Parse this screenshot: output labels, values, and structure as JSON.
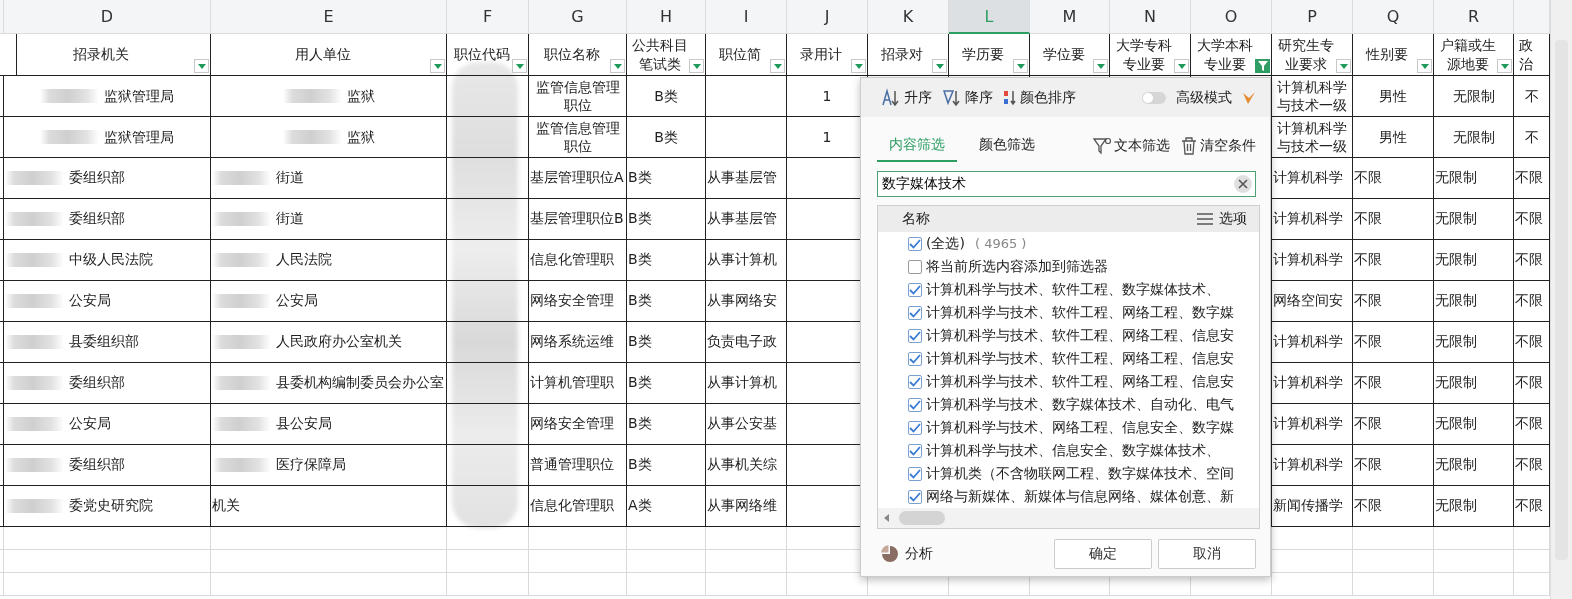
{
  "column_letters": [
    {
      "label": "D",
      "selected": false
    },
    {
      "label": "E",
      "selected": false
    },
    {
      "label": "F",
      "selected": false
    },
    {
      "label": "G",
      "selected": false
    },
    {
      "label": "H",
      "selected": false
    },
    {
      "label": "I",
      "selected": false
    },
    {
      "label": "J",
      "selected": false
    },
    {
      "label": "K",
      "selected": false
    },
    {
      "label": "L",
      "selected": true
    },
    {
      "label": "M",
      "selected": false
    },
    {
      "label": "N",
      "selected": false
    },
    {
      "label": "O",
      "selected": false
    },
    {
      "label": "P",
      "selected": false
    },
    {
      "label": "Q",
      "selected": false
    },
    {
      "label": "R",
      "selected": false
    }
  ],
  "header_row": [
    {
      "label": "招录机关",
      "kind": "filter",
      "filtered": false
    },
    {
      "label": "用人单位",
      "kind": "filter",
      "filtered": false
    },
    {
      "label": "职位代码",
      "kind": "filter",
      "filtered": false
    },
    {
      "label": "职位名称",
      "kind": "filter",
      "filtered": false
    },
    {
      "label": "公共科目笔试类",
      "kind": "filter",
      "filtered": false
    },
    {
      "label": "职位简",
      "kind": "filter",
      "filtered": false
    },
    {
      "label": "录用计",
      "kind": "filter",
      "filtered": false
    },
    {
      "label": "招录对",
      "kind": "filter",
      "filtered": false
    },
    {
      "label": "学历要",
      "kind": "filter",
      "filtered": false
    },
    {
      "label": "学位要",
      "kind": "filter",
      "filtered": false
    },
    {
      "label": "大学专科专业要",
      "kind": "filter",
      "filtered": false
    },
    {
      "label": "大学本科专业要",
      "kind": "filter",
      "filtered": true
    },
    {
      "label": "研究生专业要求",
      "kind": "filter",
      "filtered": false
    },
    {
      "label": "性别要",
      "kind": "filter",
      "filtered": false
    },
    {
      "label": "户籍或生源地要",
      "kind": "filter",
      "filtered": false
    },
    {
      "label": "政治",
      "kind": "plain"
    }
  ],
  "rows": [
    {
      "centered": true,
      "d_blurred": true,
      "e_blurred": true,
      "cells": {
        "D": "监狱管理局",
        "E": "监狱",
        "G": "监管信息管理职位",
        "H": "B类",
        "J": "1",
        "P": "计算机科学与技术一级",
        "Q": "男性",
        "R": "无限制",
        "S": "不"
      }
    },
    {
      "centered": true,
      "d_blurred": true,
      "e_blurred": true,
      "cells": {
        "D": "监狱管理局",
        "E": "监狱",
        "G": "监管信息管理职位",
        "H": "B类",
        "J": "1",
        "P": "计算机科学与技术一级",
        "Q": "男性",
        "R": "无限制",
        "S": "不"
      }
    },
    {
      "centered": false,
      "d_blurred": true,
      "e_blurred": true,
      "cells": {
        "D": "委组织部",
        "E": "街道",
        "G": "基层管理职位A",
        "H": "B类",
        "I": "从事基层管",
        "P": "计算机科学",
        "Q": "不限",
        "R": "无限制",
        "S": "不限"
      }
    },
    {
      "centered": false,
      "d_blurred": true,
      "e_blurred": true,
      "cells": {
        "D": "委组织部",
        "E": "街道",
        "G": "基层管理职位B",
        "H": "B类",
        "I": "从事基层管",
        "P": "计算机科学",
        "Q": "不限",
        "R": "无限制",
        "S": "不限"
      }
    },
    {
      "centered": false,
      "d_blurred": true,
      "e_blurred": true,
      "cells": {
        "D": "中级人民法院",
        "E": "人民法院",
        "G": "信息化管理职",
        "H": "B类",
        "I": "从事计算机",
        "P": "计算机科学",
        "Q": "不限",
        "R": "无限制",
        "S": "不限"
      }
    },
    {
      "centered": false,
      "d_blurred": true,
      "e_blurred": true,
      "cells": {
        "D": "公安局",
        "E": "公安局",
        "G": "网络安全管理",
        "H": "B类",
        "I": "从事网络安",
        "P": "网络空间安",
        "Q": "不限",
        "R": "无限制",
        "S": "不限"
      }
    },
    {
      "centered": false,
      "d_blurred": true,
      "e_blurred": true,
      "cells": {
        "D": "县委组织部",
        "E": "人民政府办公室机关",
        "G": "网络系统运维",
        "H": "B类",
        "I": "负责电子政",
        "P": "计算机科学",
        "Q": "不限",
        "R": "无限制",
        "S": "不限"
      }
    },
    {
      "centered": false,
      "d_blurred": true,
      "e_blurred": true,
      "cells": {
        "D": "委组织部",
        "E": "县委机构编制委员会办公室",
        "G": "计算机管理职",
        "H": "B类",
        "I": "从事计算机",
        "P": "计算机科学",
        "Q": "不限",
        "R": "无限制",
        "S": "不限"
      }
    },
    {
      "centered": false,
      "d_blurred": true,
      "e_blurred": true,
      "cells": {
        "D": "公安局",
        "E": "县公安局",
        "G": "网络安全管理",
        "H": "B类",
        "I": "从事公安基",
        "P": "计算机科学",
        "Q": "不限",
        "R": "无限制",
        "S": "不限"
      }
    },
    {
      "centered": false,
      "d_blurred": true,
      "e_blurred": true,
      "cells": {
        "D": "委组织部",
        "E": "医疗保障局",
        "G": "普通管理职位",
        "H": "B类",
        "I": "从事机关综",
        "P": "计算机科学",
        "Q": "不限",
        "R": "无限制",
        "S": "不限"
      }
    },
    {
      "centered": false,
      "d_blurred": true,
      "e_blurred": false,
      "cells": {
        "D": "委党史研究院",
        "E": "机关",
        "G": "信息化管理职",
        "H": "A类",
        "I": "从事网络维",
        "P": "新闻传播学",
        "Q": "不限",
        "R": "无限制",
        "S": "不限"
      }
    }
  ],
  "filter_popup": {
    "sort_buttons": [
      {
        "kind": "ascending",
        "label": "升序"
      },
      {
        "kind": "descending",
        "label": "降序"
      },
      {
        "kind": "color",
        "label": "颜色排序"
      }
    ],
    "advanced_mode": {
      "label": "高级模式",
      "on": false
    },
    "tabs": [
      {
        "label": "内容筛选",
        "selected": true
      },
      {
        "label": "颜色筛选",
        "selected": false
      }
    ],
    "actions": [
      {
        "kind": "text-filter",
        "label": "文本筛选"
      },
      {
        "kind": "clear",
        "label": "清空条件"
      }
    ],
    "search": {
      "value": "数字媒体技术"
    },
    "list_header": {
      "name": "名称",
      "options": "选项"
    },
    "items": [
      {
        "label": "(全选)",
        "count": "( 4965 )",
        "checked": true
      },
      {
        "label": "将当前所选内容添加到筛选器",
        "checked": false
      },
      {
        "label": "计算机科学与技术、软件工程、数字媒体技术、",
        "checked": true
      },
      {
        "label": "计算机科学与技术、软件工程、网络工程、数字媒",
        "checked": true
      },
      {
        "label": "计算机科学与技术、软件工程、网络工程、信息安",
        "checked": true
      },
      {
        "label": "计算机科学与技术、软件工程、网络工程、信息安",
        "checked": true
      },
      {
        "label": "计算机科学与技术、软件工程、网络工程、信息安",
        "checked": true
      },
      {
        "label": "计算机科学与技术、数字媒体技术、自动化、电气",
        "checked": true
      },
      {
        "label": "计算机科学与技术、网络工程、信息安全、数字媒",
        "checked": true
      },
      {
        "label": "计算机科学与技术、信息安全、数字媒体技术、",
        "checked": true
      },
      {
        "label": "计算机类（不含物联网工程、数字媒体技术、空间",
        "checked": true
      },
      {
        "label": "网络与新媒体、新媒体与信息网络、媒体创意、新",
        "checked": true
      }
    ],
    "analyze": "分析",
    "buttons": [
      "确定",
      "取消"
    ]
  }
}
